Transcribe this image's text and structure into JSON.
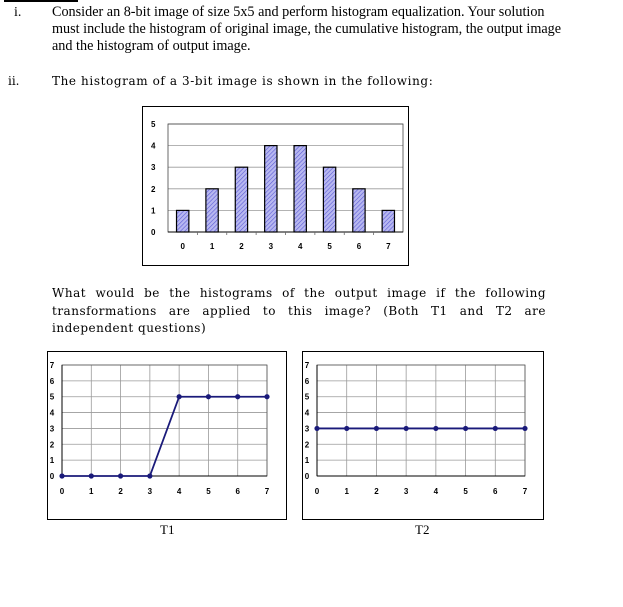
{
  "questions": [
    {
      "number": "i.",
      "lines": [
        "Consider an 8-bit image of size 5x5 and perform histogram equalization. Your solution",
        "must include the histogram of original image, the cumulative histogram, the output image",
        "and the histogram of output image."
      ]
    },
    {
      "number": "ii.",
      "text": "The histogram of a 3-bit image is shown in the following:",
      "paragraph_lines": [
        "What would be the histograms of the output image if the following",
        "transformations are applied to this image? (Both T1 and T2 are",
        "independent questions)"
      ]
    }
  ],
  "colors": {
    "bar_fill": "#b8b8f0",
    "bar_hatch": "#5c5cd6",
    "line": "#1a1a7a",
    "grid": "#9a9a9a"
  },
  "chart_data": [
    {
      "type": "bar",
      "title": "",
      "categories": [
        "0",
        "1",
        "2",
        "3",
        "4",
        "5",
        "6",
        "7"
      ],
      "values": [
        1,
        2,
        3,
        4,
        4,
        3,
        2,
        1
      ],
      "xlabel": "",
      "ylabel": "",
      "ylim": [
        0,
        5
      ],
      "yticks": [
        "0",
        "1",
        "2",
        "3",
        "4",
        "5"
      ],
      "grid": "horizontal",
      "legend": "none"
    },
    {
      "type": "line",
      "title": "",
      "caption": "T1",
      "x": [
        0,
        1,
        2,
        3,
        4,
        5,
        6,
        7
      ],
      "y": [
        0,
        0,
        0,
        0,
        5,
        5,
        5,
        5
      ],
      "xticks": [
        "0",
        "1",
        "2",
        "3",
        "4",
        "5",
        "6",
        "7"
      ],
      "yticks": [
        "0",
        "1",
        "2",
        "3",
        "4",
        "5",
        "6",
        "7"
      ],
      "xlim": [
        0,
        7
      ],
      "ylim": [
        0,
        7
      ],
      "grid": "both",
      "legend": "none"
    },
    {
      "type": "line",
      "title": "",
      "caption": "T2",
      "x": [
        0,
        1,
        2,
        3,
        4,
        5,
        6,
        7
      ],
      "y": [
        3,
        3,
        3,
        3,
        3,
        3,
        3,
        3
      ],
      "xticks": [
        "0",
        "1",
        "2",
        "3",
        "4",
        "5",
        "6",
        "7"
      ],
      "yticks": [
        "0",
        "1",
        "2",
        "3",
        "4",
        "5",
        "6",
        "7"
      ],
      "xlim": [
        0,
        7
      ],
      "ylim": [
        0,
        7
      ],
      "grid": "both",
      "legend": "none"
    }
  ]
}
